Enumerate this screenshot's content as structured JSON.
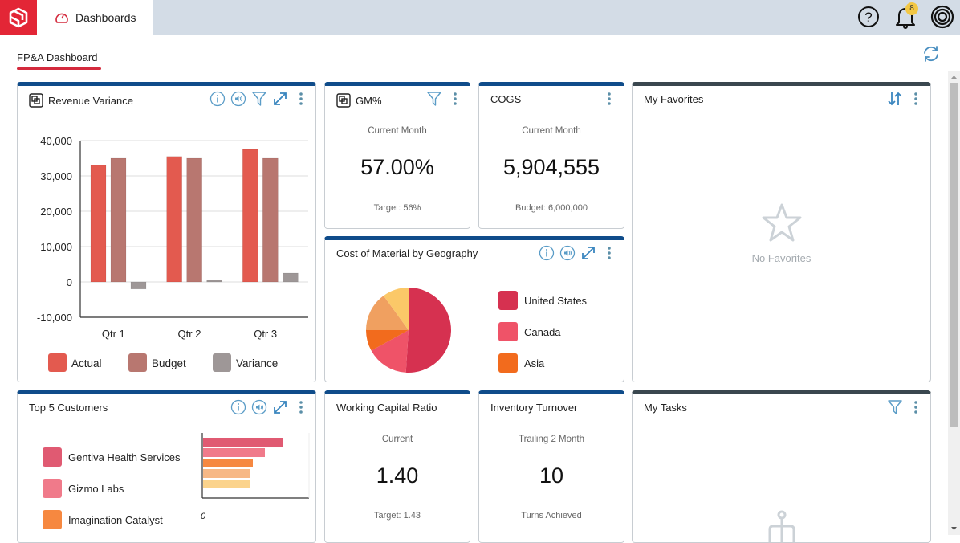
{
  "app": {
    "nav_tab_label": "Dashboards",
    "notification_count": "8",
    "icons": {
      "logo": "cube-logo-icon",
      "nav": "speedometer-icon",
      "help": "help-circle-icon",
      "notifications": "bell-icon",
      "profile": "concentric-circles-icon",
      "refresh": "refresh-icon"
    }
  },
  "page": {
    "tab_label": "FP&A Dashboard",
    "accent_color": "#d42a3d"
  },
  "cards": {
    "revenue": {
      "title": "Revenue Variance"
    },
    "gm": {
      "title": "GM%",
      "sub": "Current Month",
      "value": "57.00%",
      "foot": "Target: 56%"
    },
    "cogs": {
      "title": "COGS",
      "sub": "Current Month",
      "value": "5,904,555",
      "foot": "Budget: 6,000,000"
    },
    "favorites": {
      "title": "My Favorites",
      "empty_text": "No Favorites"
    },
    "geography": {
      "title": "Cost of Material by Geography"
    },
    "customers": {
      "title": "Top 5 Customers"
    },
    "wcr": {
      "title": "Working Capital Ratio",
      "sub": "Current",
      "value": "1.40",
      "foot": "Target: 1.43"
    },
    "inventory": {
      "title": "Inventory Turnover",
      "sub": "Trailing 2 Month",
      "value": "10",
      "foot": "Turns Achieved"
    },
    "tasks": {
      "title": "My Tasks"
    }
  },
  "chart_data": [
    {
      "type": "bar",
      "title": "Revenue Variance",
      "categories": [
        "Qtr 1",
        "Qtr 2",
        "Qtr 3"
      ],
      "series": [
        {
          "name": "Actual",
          "color": "#e35a4f",
          "values": [
            33000,
            35500,
            37500
          ]
        },
        {
          "name": "Budget",
          "color": "#b87770",
          "values": [
            35000,
            35000,
            35000
          ]
        },
        {
          "name": "Variance",
          "color": "#9e9797",
          "values": [
            -2000,
            500,
            2500
          ]
        }
      ],
      "ylim": [
        -10000,
        40000
      ],
      "yticks": [
        "40,000",
        "30,000",
        "20,000",
        "10,000",
        "0",
        "-10,000"
      ],
      "ytick_values": [
        40000,
        30000,
        20000,
        10000,
        0,
        -10000
      ],
      "grid": true,
      "legend": "bottom"
    },
    {
      "type": "pie",
      "title": "Cost of Material by Geography",
      "slices": [
        {
          "name": "United States",
          "value": 51,
          "color": "#d63150"
        },
        {
          "name": "Canada",
          "value": 16,
          "color": "#ef5368"
        },
        {
          "name": "Asia",
          "value": 8,
          "color": "#f26b1d"
        },
        {
          "name": "",
          "value": 15,
          "color": "#f0a060"
        },
        {
          "name": "",
          "value": 10,
          "color": "#fbc868"
        }
      ],
      "legend_entries": [
        "United States",
        "Canada",
        "Asia"
      ],
      "legend": "right"
    },
    {
      "type": "bar",
      "orientation": "horizontal",
      "title": "Top 5 Customers",
      "categories": [
        "Gentiva Health Services",
        "Gizmo Labs",
        "Imagination Catalyst",
        "",
        ""
      ],
      "values": [
        100,
        77,
        62,
        58,
        58
      ],
      "colors": [
        "#e05a72",
        "#f07a8a",
        "#f68840",
        "#f7b886",
        "#fbd38c"
      ],
      "legend_entries": [
        "Gentiva Health Services",
        "Gizmo Labs",
        "Imagination Catalyst"
      ],
      "xtick_label": "0",
      "legend": "left"
    }
  ]
}
